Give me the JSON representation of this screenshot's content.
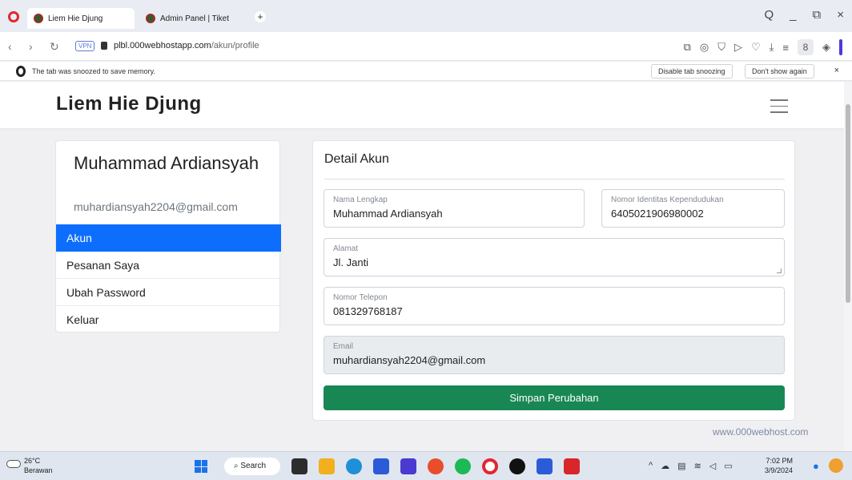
{
  "browser": {
    "tabs": [
      {
        "title": "Liem Hie Djung"
      },
      {
        "title": "Admin Panel | Tiket"
      }
    ],
    "new_tab_symbol": "+",
    "window_controls": [
      "Q",
      "_",
      "⧉",
      "×"
    ],
    "vpn_badge": "VPN",
    "url_host": "plbl.000webhostapp.com",
    "url_path": "/akun/profile",
    "toolbar_icons": [
      "snapshot-icon",
      "camera-icon",
      "shield-icon",
      "send-icon",
      "heart-icon",
      "download-icon",
      "menu-icon",
      "profile-icon",
      "extensions-icon"
    ],
    "snooze": {
      "message": "The tab was snoozed to save memory.",
      "disable_btn": "Disable tab snoozing",
      "dont_show_btn": "Don't show again",
      "close": "×"
    }
  },
  "site": {
    "brand": "Liem Hie Djung",
    "user": {
      "name": "Muhammad Ardiansyah",
      "email": "muhardiansyah2204@gmail.com"
    },
    "menu": [
      {
        "label": "Akun"
      },
      {
        "label": "Pesanan Saya"
      },
      {
        "label": "Ubah Password"
      },
      {
        "label": "Keluar"
      }
    ],
    "detail": {
      "title": "Detail Akun",
      "fields": {
        "nama": {
          "label": "Nama Lengkap",
          "value": "Muhammad Ardiansyah"
        },
        "nik": {
          "label": "Nomor Identitas Kependudukan",
          "value": "6405021906980002"
        },
        "alamat": {
          "label": "Alamat",
          "value": "Jl. Janti"
        },
        "telepon": {
          "label": "Nomor Telepon",
          "value": "081329768187"
        },
        "email": {
          "label": "Email",
          "value": "muhardiansyah2204@gmail.com"
        }
      },
      "save_label": "Simpan Perubahan"
    },
    "host_badge": "www.000webhost.com"
  },
  "taskbar": {
    "weather_temp": "26°C",
    "weather_desc": "Berawan",
    "search_label": "Search",
    "time": "7:02 PM",
    "date": "3/9/2024"
  },
  "colors": {
    "primary": "#0d6efd",
    "success": "#198754",
    "opera_red": "#e3262f"
  }
}
